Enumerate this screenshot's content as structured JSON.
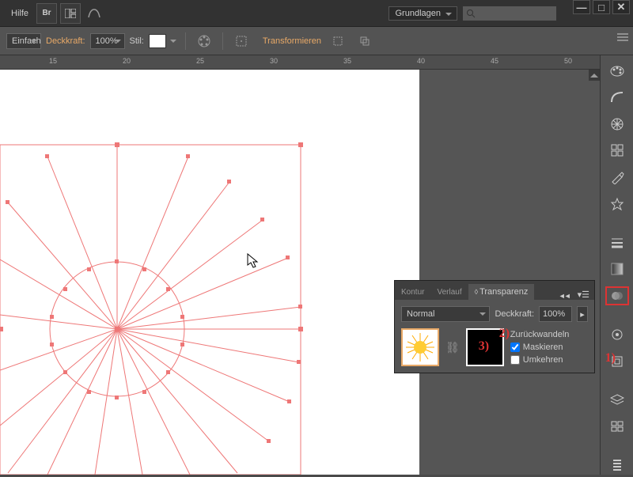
{
  "menubar": {
    "help": "Hilfe",
    "workspace": "Grundlagen"
  },
  "controlbar": {
    "simple": "Einfach",
    "opacity_label": "Deckkraft:",
    "opacity_value": "100%",
    "style_label": "Stil:",
    "transform": "Transformieren"
  },
  "ruler": {
    "ticks": [
      "15",
      "20",
      "25",
      "30",
      "35",
      "40",
      "45",
      "50"
    ]
  },
  "panel": {
    "tabs": {
      "kontur": "Kontur",
      "verlauf": "Verlauf",
      "transparenz": "Transparenz"
    },
    "blend": "Normal",
    "opacity_label": "Deckkraft:",
    "opacity_value": "100%",
    "revert": "Zurückwandeln",
    "mask": "Maskieren",
    "invert": "Umkehren"
  },
  "annotations": {
    "a1": "1)",
    "a2": "2)",
    "a3": "3)"
  }
}
